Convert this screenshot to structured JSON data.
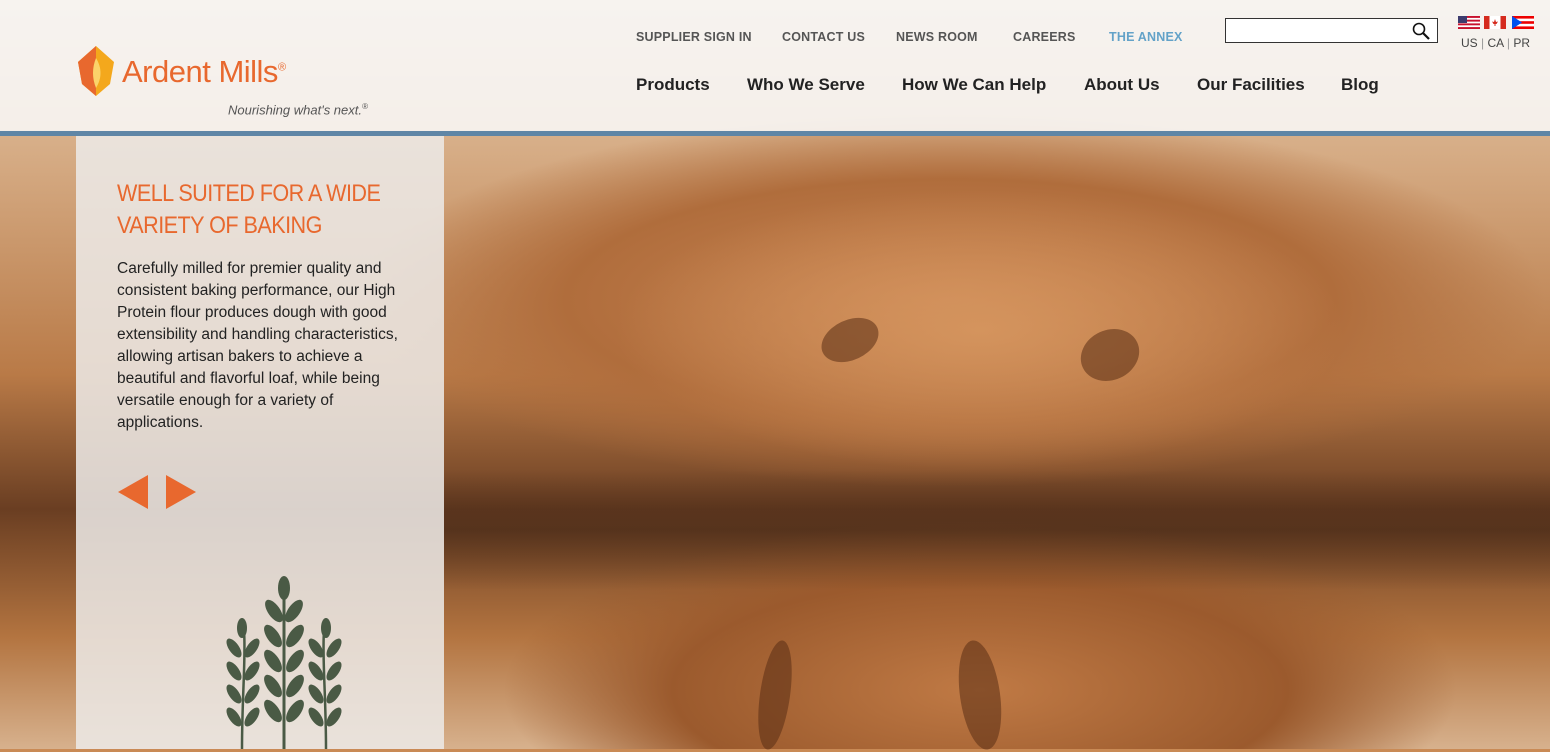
{
  "brand": {
    "name": "Ardent Mills",
    "registered": "®",
    "tagline": "Nourishing what's next.",
    "tagline_mark": "®"
  },
  "utility_nav": [
    {
      "label": "SUPPLIER SIGN IN"
    },
    {
      "label": "CONTACT US"
    },
    {
      "label": "NEWS ROOM"
    },
    {
      "label": "CAREERS"
    },
    {
      "label": "THE ANNEX"
    }
  ],
  "main_nav": [
    {
      "label": "Products"
    },
    {
      "label": "Who We Serve"
    },
    {
      "label": "How We Can Help"
    },
    {
      "label": "About Us"
    },
    {
      "label": "Our Facilities"
    },
    {
      "label": "Blog"
    }
  ],
  "search": {
    "value": "",
    "icon": "search-icon"
  },
  "locales": {
    "flags": [
      "us-flag-icon",
      "canada-flag-icon",
      "puerto-rico-flag-icon"
    ],
    "us": "US",
    "ca": "CA",
    "pr": "PR",
    "separator": "|"
  },
  "hero": {
    "title": "WELL SUITED FOR A WIDE VARIETY OF BAKING",
    "body": "Carefully milled for premier quality and consistent baking performance, our High Protein flour produces dough with good extensibility and handling characteristics, allowing artisan bakers to achieve a beautiful and flavorful loaf, while being versatile enough for a variety of applications.",
    "prev_icon": "arrow-left-icon",
    "next_icon": "arrow-right-icon",
    "decor_icon": "wheat-icon"
  },
  "colors": {
    "accent": "#e8682e",
    "header_rule": "#5f86a6",
    "annex_link": "#63a2c8",
    "wheat": "#4a5a45"
  }
}
